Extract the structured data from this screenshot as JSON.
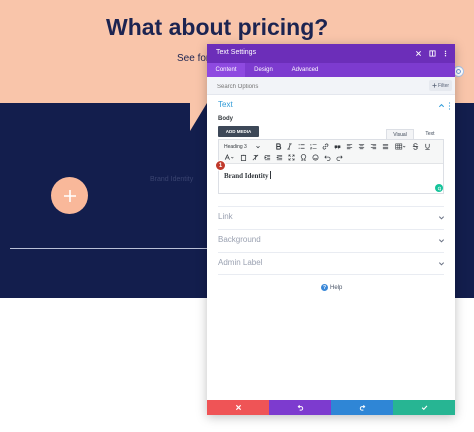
{
  "page": {
    "headline": "What about pricing?",
    "subline": "See for",
    "ghost_text": "Brand Identity"
  },
  "modal": {
    "title": "Text Settings",
    "tabs": [
      {
        "label": "Content",
        "active": true
      },
      {
        "label": "Design",
        "active": false
      },
      {
        "label": "Advanced",
        "active": false
      }
    ],
    "search": {
      "placeholder": "Search Options",
      "filter_label": "Filter"
    },
    "sections": {
      "text": {
        "title": "Text",
        "open": true
      },
      "link": {
        "title": "Link"
      },
      "background": {
        "title": "Background"
      },
      "admin_label": {
        "title": "Admin Label"
      }
    },
    "body_label": "Body",
    "add_media_label": "ADD MEDIA",
    "editor_tabs": {
      "visual": "Visual",
      "text": "Text"
    },
    "format_select": "Heading 3",
    "toolbar_icons": [
      "bold-icon",
      "italic-icon",
      "bullet-list-icon",
      "numbered-list-icon",
      "link-icon",
      "blockquote-icon",
      "align-left-icon",
      "align-center-icon",
      "align-right-icon",
      "align-justify-icon",
      "table-icon",
      "strikethrough-icon",
      "underline-icon",
      "text-color-icon",
      "paste-text-icon",
      "clear-format-icon",
      "indent-icon",
      "outdent-icon",
      "fullscreen-icon",
      "special-char-icon",
      "emoji-icon",
      "undo-icon",
      "redo-icon"
    ],
    "editor_content": "Brand Identity",
    "step_badge": "1",
    "help_label": "Help"
  },
  "colors": {
    "peach": "#f9c5aa",
    "navy": "#131e4d",
    "header_purple": "#6c2eb9",
    "cancel": "#ef5456",
    "undo": "#7d3bcf",
    "redo": "#2f86d6",
    "save": "#27b593"
  }
}
